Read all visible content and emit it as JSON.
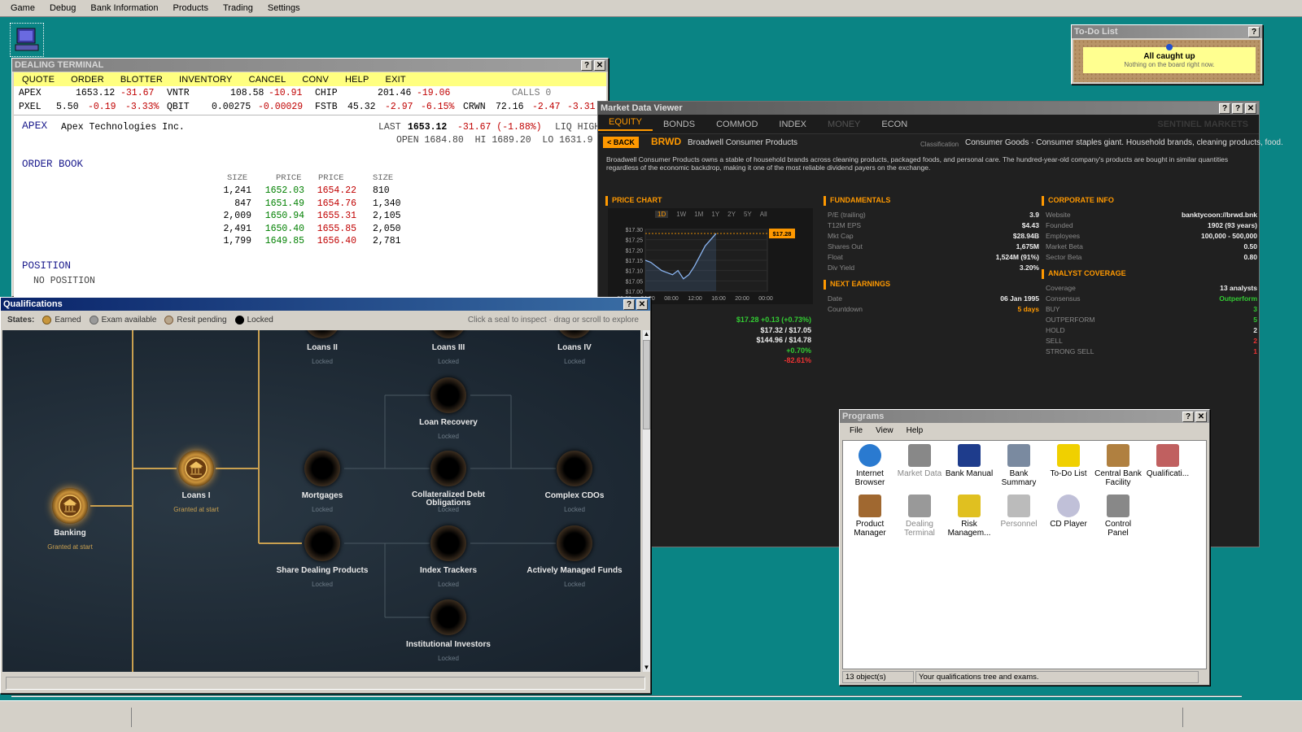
{
  "menubar": [
    "Game",
    "Debug",
    "Bank Information",
    "Products",
    "Trading",
    "Settings"
  ],
  "dealing": {
    "title": "DEALING TERMINAL",
    "menu": [
      "QUOTE",
      "ORDER",
      "BLOTTER",
      "INVENTORY",
      "CANCEL",
      "CONV",
      "HELP",
      "EXIT"
    ],
    "tickers_row1": [
      {
        "sym": "APEX",
        "price": "1653.12",
        "chg": "-31.67"
      },
      {
        "sym": "VNTR",
        "price": "108.58",
        "chg": "-10.91"
      },
      {
        "sym": "CHIP",
        "price": "201.46",
        "chg": "-19.06"
      }
    ],
    "calls": "CALLS 0",
    "tickers_row2": [
      {
        "sym": "PXEL",
        "price": "5.50",
        "chg": "-0.19",
        "pct": "-3.33%"
      },
      {
        "sym": "QBIT",
        "price": "0.00275",
        "chg": "-0.00029",
        "pct": ""
      },
      {
        "sym": "FSTB",
        "price": "45.32",
        "chg": "-2.97",
        "pct": "-6.15%"
      },
      {
        "sym": "CRWN",
        "price": "72.16",
        "chg": "-2.47",
        "pct": "-3.31"
      }
    ],
    "symbol": "APEX",
    "company": "Apex Technologies Inc.",
    "last_label": "LAST",
    "last": "1653.12",
    "last_chg": "-31.67 (-1.88%)",
    "liq": "LIQ HIGH",
    "open_line": "OPEN 1684.80  HI 1689.20  LO 1631.9",
    "order_book_title": "ORDER BOOK",
    "ob_headers": [
      "SIZE",
      "PRICE",
      "PRICE",
      "SIZE"
    ],
    "ob_rows": [
      [
        "1,241",
        "1652.03",
        "1654.22",
        "810"
      ],
      [
        "847",
        "1651.49",
        "1654.76",
        "1,340"
      ],
      [
        "2,009",
        "1650.94",
        "1655.31",
        "2,105"
      ],
      [
        "2,491",
        "1650.40",
        "1655.85",
        "2,050"
      ],
      [
        "1,799",
        "1649.85",
        "1656.40",
        "2,781"
      ]
    ],
    "position_title": "POSITION",
    "position": "NO POSITION"
  },
  "todo": {
    "title": "To-Do List",
    "headline": "All caught up",
    "sub": "Nothing on the board right now."
  },
  "mdv": {
    "title": "Market Data Viewer",
    "tabs": [
      "EQUITY",
      "BONDS",
      "COMMOD",
      "INDEX",
      "MONEY",
      "ECON"
    ],
    "brand": "SENTINEL MARKETS",
    "back": "< BACK",
    "ticker": "BRWD",
    "name": "Broadwell Consumer Products",
    "class_label": "Classification",
    "classification": "Consumer Goods · Consumer staples giant. Household brands, cleaning products, food.",
    "desc1": "Broadwell Consumer Products owns a stable of household brands across cleaning products, packaged foods, and personal care. The hundred-year-old company's products are bought in similar quantities",
    "desc2": "regardless of the economic backdrop, making it one of the most reliable dividend payers on the exchange.",
    "price_chart": "PRICE CHART",
    "ranges": [
      "1D",
      "1W",
      "1M",
      "1Y",
      "2Y",
      "5Y",
      "All"
    ],
    "yticks": [
      "$17.30",
      "$17.25",
      "$17.20",
      "$17.15",
      "$17.10",
      "$17.05",
      "$17.00"
    ],
    "xticks": [
      "00:00",
      "04:00",
      "08:00",
      "12:00",
      "16:00",
      "20:00",
      "00:00"
    ],
    "price_tag": "$17.28",
    "stat1": "$17.28  +0.13 (+0.73%)",
    "stat2": "$17.32 / $17.05",
    "stat3": "$144.96 / $14.78",
    "stat4": "+0.70%",
    "stat5": "-82.61%",
    "fund_title": "FUNDAMENTALS",
    "fundamentals": [
      [
        "P/E (trailing)",
        "3.9"
      ],
      [
        "T12M EPS",
        "$4.43"
      ],
      [
        "Mkt Cap",
        "$28.94B"
      ],
      [
        "Shares Out",
        "1,675M"
      ],
      [
        "Float",
        "1,524M (91%)"
      ],
      [
        "Div Yield",
        "3.20%"
      ]
    ],
    "earn_title": "NEXT EARNINGS",
    "earnings": [
      [
        "Date",
        "06 Jan 1995"
      ],
      [
        "Countdown",
        "5 days"
      ]
    ],
    "corp_title": "CORPORATE INFO",
    "corp": [
      [
        "Website",
        "banktycoon://brwd.bnk"
      ],
      [
        "Founded",
        "1902 (93 years)"
      ],
      [
        "Employees",
        "100,000 - 500,000"
      ],
      [
        "Market Beta",
        "0.50"
      ],
      [
        "Sector Beta",
        "0.80"
      ]
    ],
    "analyst_title": "ANALYST COVERAGE",
    "analyst": [
      [
        "Coverage",
        "13 analysts"
      ],
      [
        "Consensus",
        "Outperform"
      ],
      [
        "BUY",
        "3"
      ],
      [
        "OUTPERFORM",
        "5"
      ],
      [
        "HOLD",
        "2"
      ],
      [
        "SELL",
        "2"
      ],
      [
        "STRONG SELL",
        "1"
      ]
    ]
  },
  "chart_data": {
    "type": "line",
    "x": [
      "00:00",
      "04:00",
      "08:00",
      "12:00",
      "16:00",
      "20:00",
      "00:00"
    ],
    "ylim": [
      17.0,
      17.3
    ],
    "series": [
      {
        "values": [
          17.15,
          17.14,
          17.12,
          17.1,
          17.09,
          17.08,
          17.1,
          17.06,
          17.08,
          17.12,
          17.17,
          17.22,
          17.25,
          17.28
        ]
      }
    ]
  },
  "qual": {
    "title": "Qualifications",
    "states_label": "States:",
    "states": [
      "Earned",
      "Exam available",
      "Resit pending",
      "Locked"
    ],
    "hint": "Click a seal to inspect · drag or scroll to explore",
    "nodes": [
      {
        "name": "Loans II",
        "sub": "Locked"
      },
      {
        "name": "Loans III",
        "sub": "Locked"
      },
      {
        "name": "Loans IV",
        "sub": "Locked"
      },
      {
        "name": "Loan Recovery",
        "sub": "Locked"
      },
      {
        "name": "Loans I",
        "sub": "Granted at start"
      },
      {
        "name": "Mortgages",
        "sub": "Locked"
      },
      {
        "name": "Collateralized Debt Obligations",
        "sub": "Locked"
      },
      {
        "name": "Complex CDOs",
        "sub": "Locked"
      },
      {
        "name": "Banking",
        "sub": "Granted at start"
      },
      {
        "name": "Share Dealing Products",
        "sub": "Locked"
      },
      {
        "name": "Index Trackers",
        "sub": "Locked"
      },
      {
        "name": "Actively Managed Funds",
        "sub": "Locked"
      },
      {
        "name": "Institutional Investors",
        "sub": "Locked"
      }
    ]
  },
  "programs": {
    "title": "Programs",
    "menu": [
      "File",
      "View",
      "Help"
    ],
    "items": [
      "Internet Browser",
      "Market Data",
      "Bank Manual",
      "Bank Summary",
      "To-Do List",
      "Central Bank Facility",
      "Qualificati...",
      "Product Manager",
      "Dealing Terminal",
      "Risk Managem...",
      "Personnel",
      "CD Player",
      "Control Panel"
    ],
    "status_count": "13 object(s)",
    "status_text": "Your qualifications tree and exams."
  }
}
